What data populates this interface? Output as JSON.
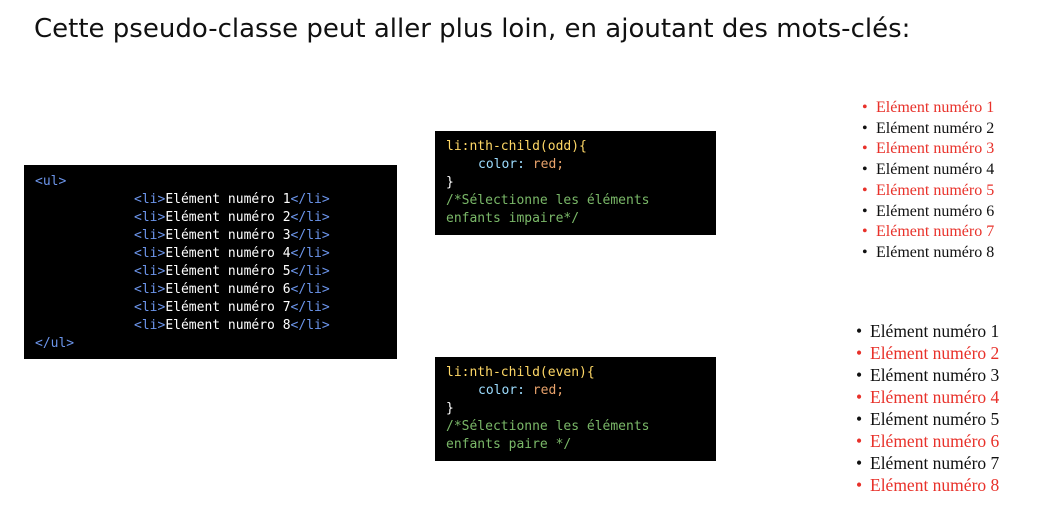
{
  "title": "Cette pseudo-classe peut aller plus loin, en ajoutant des mots-clés:",
  "html_code": {
    "open_tag": "<ul>",
    "close_tag": "</ul>",
    "li_open": "<li>",
    "li_close": "</li>",
    "items": [
      "Elément numéro 1",
      "Elément numéro 2",
      "Elément numéro 3",
      "Elément numéro 4",
      "Elément numéro 5",
      "Elément numéro 6",
      "Elément numéro 7",
      "Elément numéro 8"
    ]
  },
  "css_odd": {
    "selector": "li:nth-child(odd){",
    "property": "color:",
    "value": "red;",
    "close": "}",
    "comment_line1": "/*Sélectionne les éléments",
    "comment_line2": "enfants impaire*/"
  },
  "css_even": {
    "selector": "li:nth-child(even){",
    "property": "color:",
    "value": "red;",
    "close": "}",
    "comment_line1": "/*Sélectionne les éléments",
    "comment_line2": "enfants paire */"
  },
  "odd_result": {
    "highlight": "odd",
    "items": [
      "Elément numéro 1",
      "Elément numéro 2",
      "Elément numéro 3",
      "Elément numéro 4",
      "Elément numéro 5",
      "Elément numéro 6",
      "Elément numéro 7",
      "Elément numéro 8"
    ]
  },
  "even_result": {
    "highlight": "even",
    "items": [
      "Elément numéro 1",
      "Elément numéro 2",
      "Elément numéro 3",
      "Elément numéro 4",
      "Elément numéro 5",
      "Elément numéro 6",
      "Elément numéro 7",
      "Elément numéro 8"
    ]
  },
  "colors": {
    "highlight": "#e8312a",
    "code_bg": "#000000",
    "tag": "#6c95eb",
    "selector": "#ffd866",
    "comment": "#7ab868"
  }
}
